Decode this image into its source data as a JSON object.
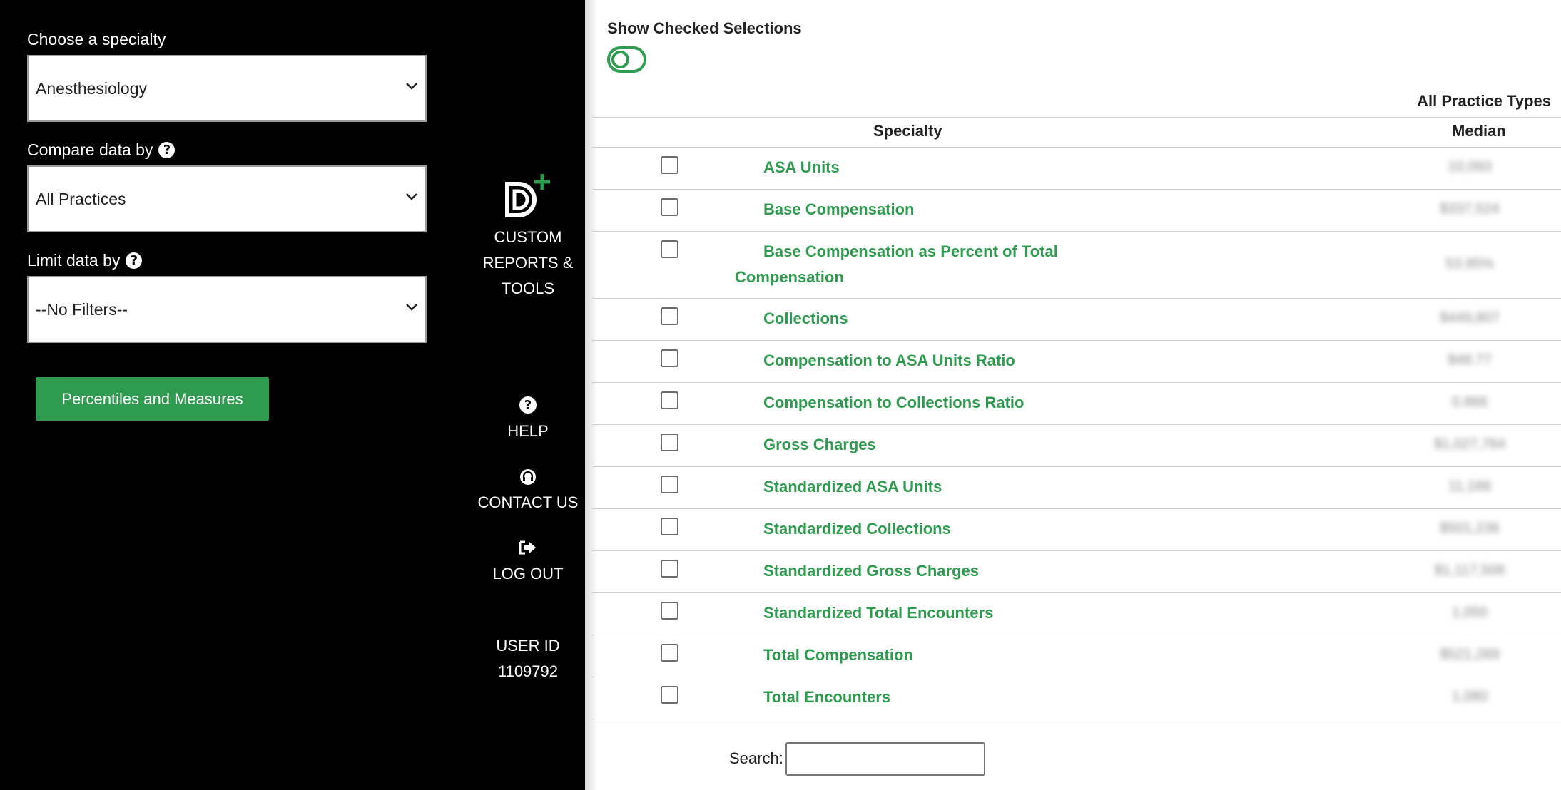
{
  "filters": {
    "specialty_label": "Choose a specialty",
    "specialty_value": "Anesthesiology",
    "compare_label": "Compare data by",
    "compare_value": "All Practices",
    "limit_label": "Limit data by",
    "limit_value": "--No Filters--",
    "percentiles_button": "Percentiles and Measures"
  },
  "nav": {
    "custom_reports": [
      "CUSTOM",
      "REPORTS &",
      "TOOLS"
    ],
    "help": "HELP",
    "contact": "CONTACT US",
    "logout": "LOG OUT",
    "user_id_label": "USER ID",
    "user_id": "1109792"
  },
  "main": {
    "show_checked_label": "Show Checked Selections",
    "column_group_header": "All Practice Types",
    "col_specialty": "Specialty",
    "col_median": "Median",
    "rows": [
      {
        "label": "ASA Units",
        "median": "10,093"
      },
      {
        "label": "Base Compensation",
        "median": "$337,524"
      },
      {
        "label": "Base Compensation as Percent of Total Compensation",
        "median": "53.95%"
      },
      {
        "label": "Collections",
        "median": "$449,807"
      },
      {
        "label": "Compensation to ASA Units Ratio",
        "median": "$48.77"
      },
      {
        "label": "Compensation to Collections Ratio",
        "median": "0.866"
      },
      {
        "label": "Gross Charges",
        "median": "$1,027,764"
      },
      {
        "label": "Standardized ASA Units",
        "median": "11,166"
      },
      {
        "label": "Standardized Collections",
        "median": "$501,236"
      },
      {
        "label": "Standardized Gross Charges",
        "median": "$1,117,508"
      },
      {
        "label": "Standardized Total Encounters",
        "median": "1,050"
      },
      {
        "label": "Total Compensation",
        "median": "$521,269"
      },
      {
        "label": "Total Encounters",
        "median": "1,080"
      }
    ],
    "search_label": "Search:",
    "search_value": ""
  },
  "colors": {
    "accent": "#2e9b4e",
    "sidebar_bg": "#000000",
    "text": "#222222"
  },
  "icons": [
    "chevron-down-icon",
    "help-circle-icon",
    "logo-d-plus-icon",
    "headset-icon",
    "logout-icon"
  ]
}
